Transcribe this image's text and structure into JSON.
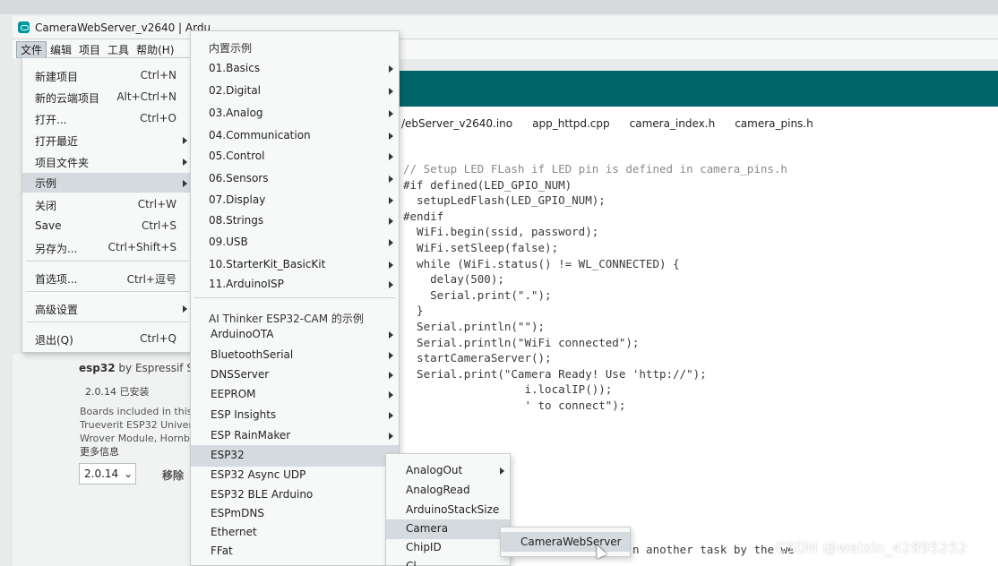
{
  "window": {
    "title": "CameraWebServer_v2640 | Ardu"
  },
  "menubar": [
    "文件",
    "编辑",
    "项目",
    "工具",
    "帮助(H)"
  ],
  "file_menu": [
    {
      "label": "新建项目",
      "shortcut": "Ctrl+N"
    },
    {
      "label": "新的云端项目",
      "shortcut": "Alt+Ctrl+N"
    },
    {
      "label": "打开...",
      "shortcut": "Ctrl+O"
    },
    {
      "label": "打开最近",
      "shortcut": ""
    },
    {
      "label": "项目文件夹",
      "shortcut": ""
    },
    {
      "label": "示例",
      "shortcut": ""
    },
    {
      "label": "关闭",
      "shortcut": "Ctrl+W"
    },
    {
      "label": "Save",
      "shortcut": "Ctrl+S"
    },
    {
      "label": "另存为...",
      "shortcut": "Ctrl+Shift+S"
    },
    {
      "label": "首选项...",
      "shortcut": "Ctrl+逗号"
    },
    {
      "label": "高级设置",
      "shortcut": ""
    },
    {
      "label": "退出(Q)",
      "shortcut": "Ctrl+Q"
    }
  ],
  "examples_menu": {
    "builtin_header": "内置示例",
    "builtin": [
      "01.Basics",
      "02.Digital",
      "03.Analog",
      "04.Communication",
      "05.Control",
      "06.Sensors",
      "07.Display",
      "08.Strings",
      "09.USB",
      "10.StarterKit_BasicKit",
      "11.ArduinoISP"
    ],
    "board_header": "AI Thinker ESP32-CAM 的示例",
    "board": [
      "ArduinoOTA",
      "BluetoothSerial",
      "DNSServer",
      "EEPROM",
      "ESP Insights",
      "ESP RainMaker",
      "ESP32",
      "ESP32 Async UDP",
      "ESP32 BLE Arduino",
      "ESPmDNS",
      "Ethernet",
      "FFat"
    ]
  },
  "esp32_menu": [
    "AnalogOut",
    "AnalogRead",
    "ArduinoStackSize",
    "Camera",
    "ChipID",
    "Cl"
  ],
  "camera_menu": [
    "CameraWebServer"
  ],
  "tabs": [
    "/ebServer_v2640.ino",
    "app_httpd.cpp",
    "camera_index.h",
    "camera_pins.h"
  ],
  "code_lines": [
    "// Setup LED FLash if LED pin is defined in camera_pins.h",
    "#if defined(LED_GPIO_NUM)",
    "  setupLedFlash(LED_GPIO_NUM);",
    "#endif",
    "",
    "  WiFi.begin(ssid, password);",
    "  WiFi.setSleep(false);",
    "",
    "  while (WiFi.status() != WL_CONNECTED) {",
    "    delay(500);",
    "    Serial.print(\".\");",
    "  }",
    "  Serial.println(\"\");",
    "  Serial.println(\"WiFi connected\");",
    "",
    "  startCameraServer();",
    "",
    "  Serial.print(\"Camera Ready! Use 'http://\");",
    "                  i.localIP());",
    "                  ' to connect\");"
  ],
  "code_tail": "n another task by the we",
  "board_panel": {
    "name": "esp32",
    "author": "by Espressif Sy",
    "installed": "2.0.14 已安装",
    "description": [
      "Boards included in this",
      "Trueverit ESP32 Univer",
      "Wrover Module, Hornb"
    ],
    "more_info": "更多信息",
    "version": "2.0.14",
    "remove": "移除"
  },
  "watermark": "CSDN @weixin_42895252",
  "colors": {
    "toolbar": "#006468",
    "menu_highlight": "#d4dadd"
  }
}
